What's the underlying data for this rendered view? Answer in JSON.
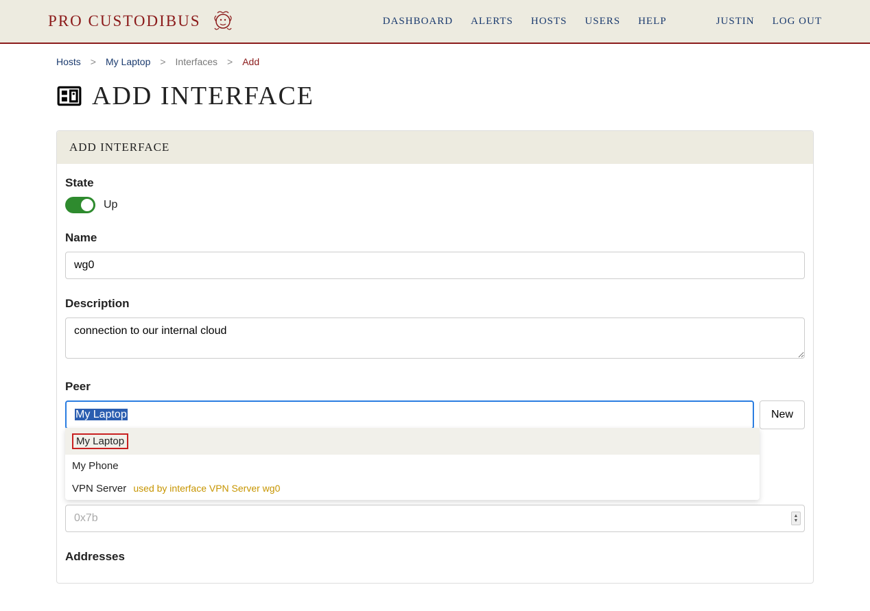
{
  "brand": "PRO CUSTODIBUS",
  "nav": {
    "dashboard": "DASHBOARD",
    "alerts": "ALERTS",
    "hosts": "HOSTS",
    "users": "USERS",
    "help": "HELP",
    "user": "JUSTIN",
    "logout": "LOG OUT"
  },
  "breadcrumb": {
    "hosts": "Hosts",
    "host": "My Laptop",
    "interfaces": "Interfaces",
    "current": "Add"
  },
  "page_title": "ADD INTERFACE",
  "panel_title": "ADD INTERFACE",
  "fields": {
    "state": {
      "label": "State",
      "value_label": "Up"
    },
    "name": {
      "label": "Name",
      "value": "wg0"
    },
    "description": {
      "label": "Description",
      "value": "connection to our internal cloud"
    },
    "peer": {
      "label": "Peer",
      "value": "My Laptop",
      "new_button": "New",
      "options": [
        {
          "label": "My Laptop",
          "note": "",
          "highlighted": true,
          "boxed": true
        },
        {
          "label": "My Phone",
          "note": "",
          "highlighted": false,
          "boxed": false
        },
        {
          "label": "VPN Server",
          "note": "used by interface VPN Server wg0",
          "highlighted": false,
          "boxed": false
        }
      ]
    },
    "hidden_number": {
      "placeholder": "0x7b"
    },
    "addresses": {
      "label": "Addresses"
    }
  }
}
